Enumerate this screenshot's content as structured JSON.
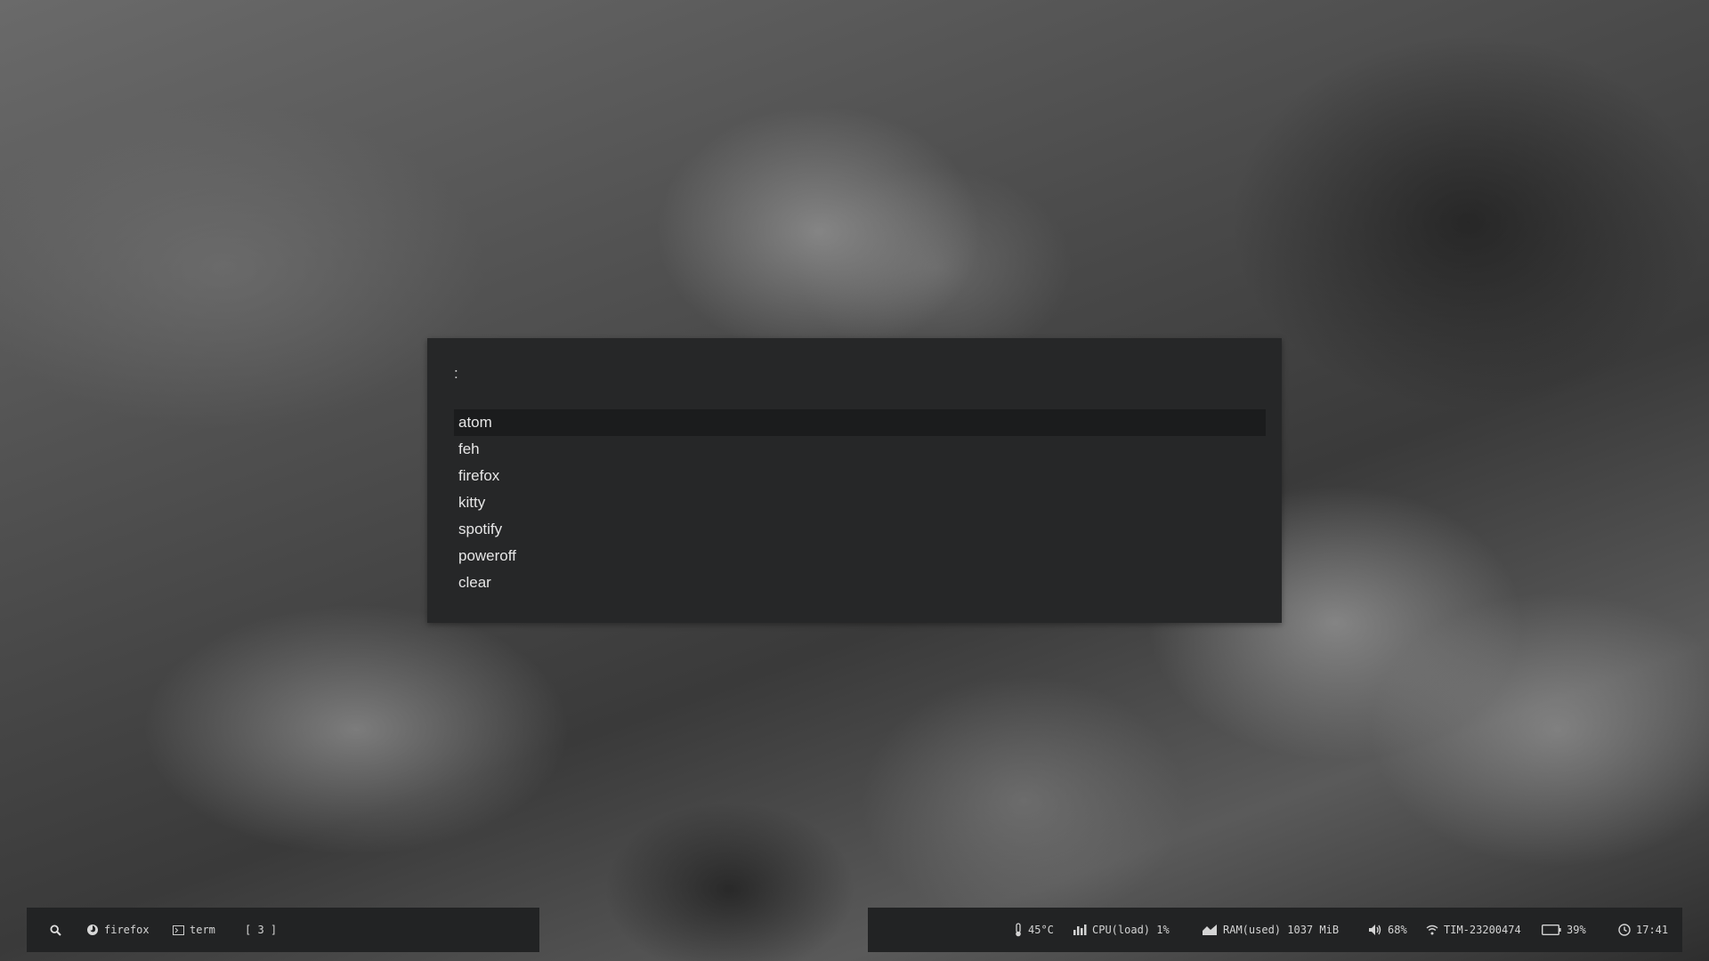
{
  "launcher": {
    "prompt": ":",
    "selected_index": 0,
    "results": [
      "atom",
      "feh",
      "firefox",
      "kitty",
      "spotify",
      "poweroff",
      "clear"
    ]
  },
  "taskbar_left": {
    "search_icon": "search-icon",
    "firefox_label": "firefox",
    "firefox_icon": "firefox-icon",
    "term_label": "term",
    "term_icon": "terminal-icon",
    "workspace": "[ 3 ]"
  },
  "taskbar_right": {
    "temperature": "45°C",
    "cpu": "CPU(load) 1%",
    "ram": "RAM(used) 1037 MiB",
    "volume": "68%",
    "wifi": "TIM-23200474",
    "battery": "39%",
    "clock": "17:41"
  },
  "colors": {
    "panel_bg": "#262728",
    "selected_bg": "#1b1c1d",
    "bar_bg": "#222324",
    "text": "#d4d4d4"
  }
}
